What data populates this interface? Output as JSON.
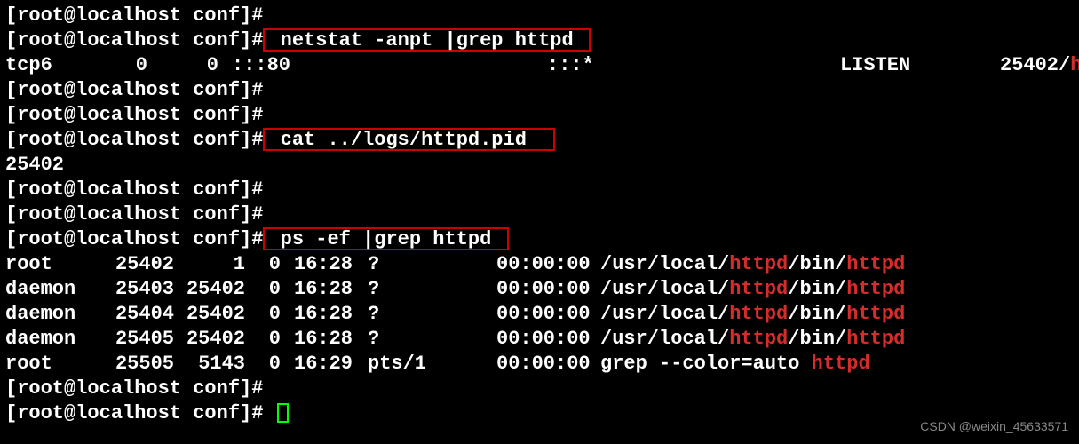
{
  "prompt": "[root@localhost conf]#",
  "cmd_netstat": " netstat -anpt |grep httpd ",
  "netstat_out": {
    "proto": "tcp6",
    "recvq": "0",
    "sendq": "0",
    "local": ":::80",
    "foreign": ":::*",
    "state": "LISTEN",
    "pidprog_pre": "25402/",
    "pidprog_hl": "h"
  },
  "cmd_cat": " cat ../logs/httpd.pid  ",
  "cat_out": "25402",
  "cmd_ps": " ps -ef |grep httpd ",
  "ps_rows": [
    {
      "uid": "root",
      "pid": "25402",
      "ppid": "1",
      "c": "0",
      "stime": "16:28",
      "tty": "?",
      "time": "00:00:00",
      "pre": "/usr/local/",
      "h1": "httpd",
      "mid": "/bin/",
      "h2": "httpd"
    },
    {
      "uid": "daemon",
      "pid": "25403",
      "ppid": "25402",
      "c": "0",
      "stime": "16:28",
      "tty": "?",
      "time": "00:00:00",
      "pre": "/usr/local/",
      "h1": "httpd",
      "mid": "/bin/",
      "h2": "httpd"
    },
    {
      "uid": "daemon",
      "pid": "25404",
      "ppid": "25402",
      "c": "0",
      "stime": "16:28",
      "tty": "?",
      "time": "00:00:00",
      "pre": "/usr/local/",
      "h1": "httpd",
      "mid": "/bin/",
      "h2": "httpd"
    },
    {
      "uid": "daemon",
      "pid": "25405",
      "ppid": "25402",
      "c": "0",
      "stime": "16:28",
      "tty": "?",
      "time": "00:00:00",
      "pre": "/usr/local/",
      "h1": "httpd",
      "mid": "/bin/",
      "h2": "httpd"
    },
    {
      "uid": "root",
      "pid": "25505",
      "ppid": "5143",
      "c": "0",
      "stime": "16:29",
      "tty": "pts/1",
      "time": "00:00:00",
      "pre": "grep --color=auto ",
      "h1": "httpd",
      "mid": "",
      "h2": ""
    }
  ],
  "watermark": "CSDN @weixin_45633571"
}
